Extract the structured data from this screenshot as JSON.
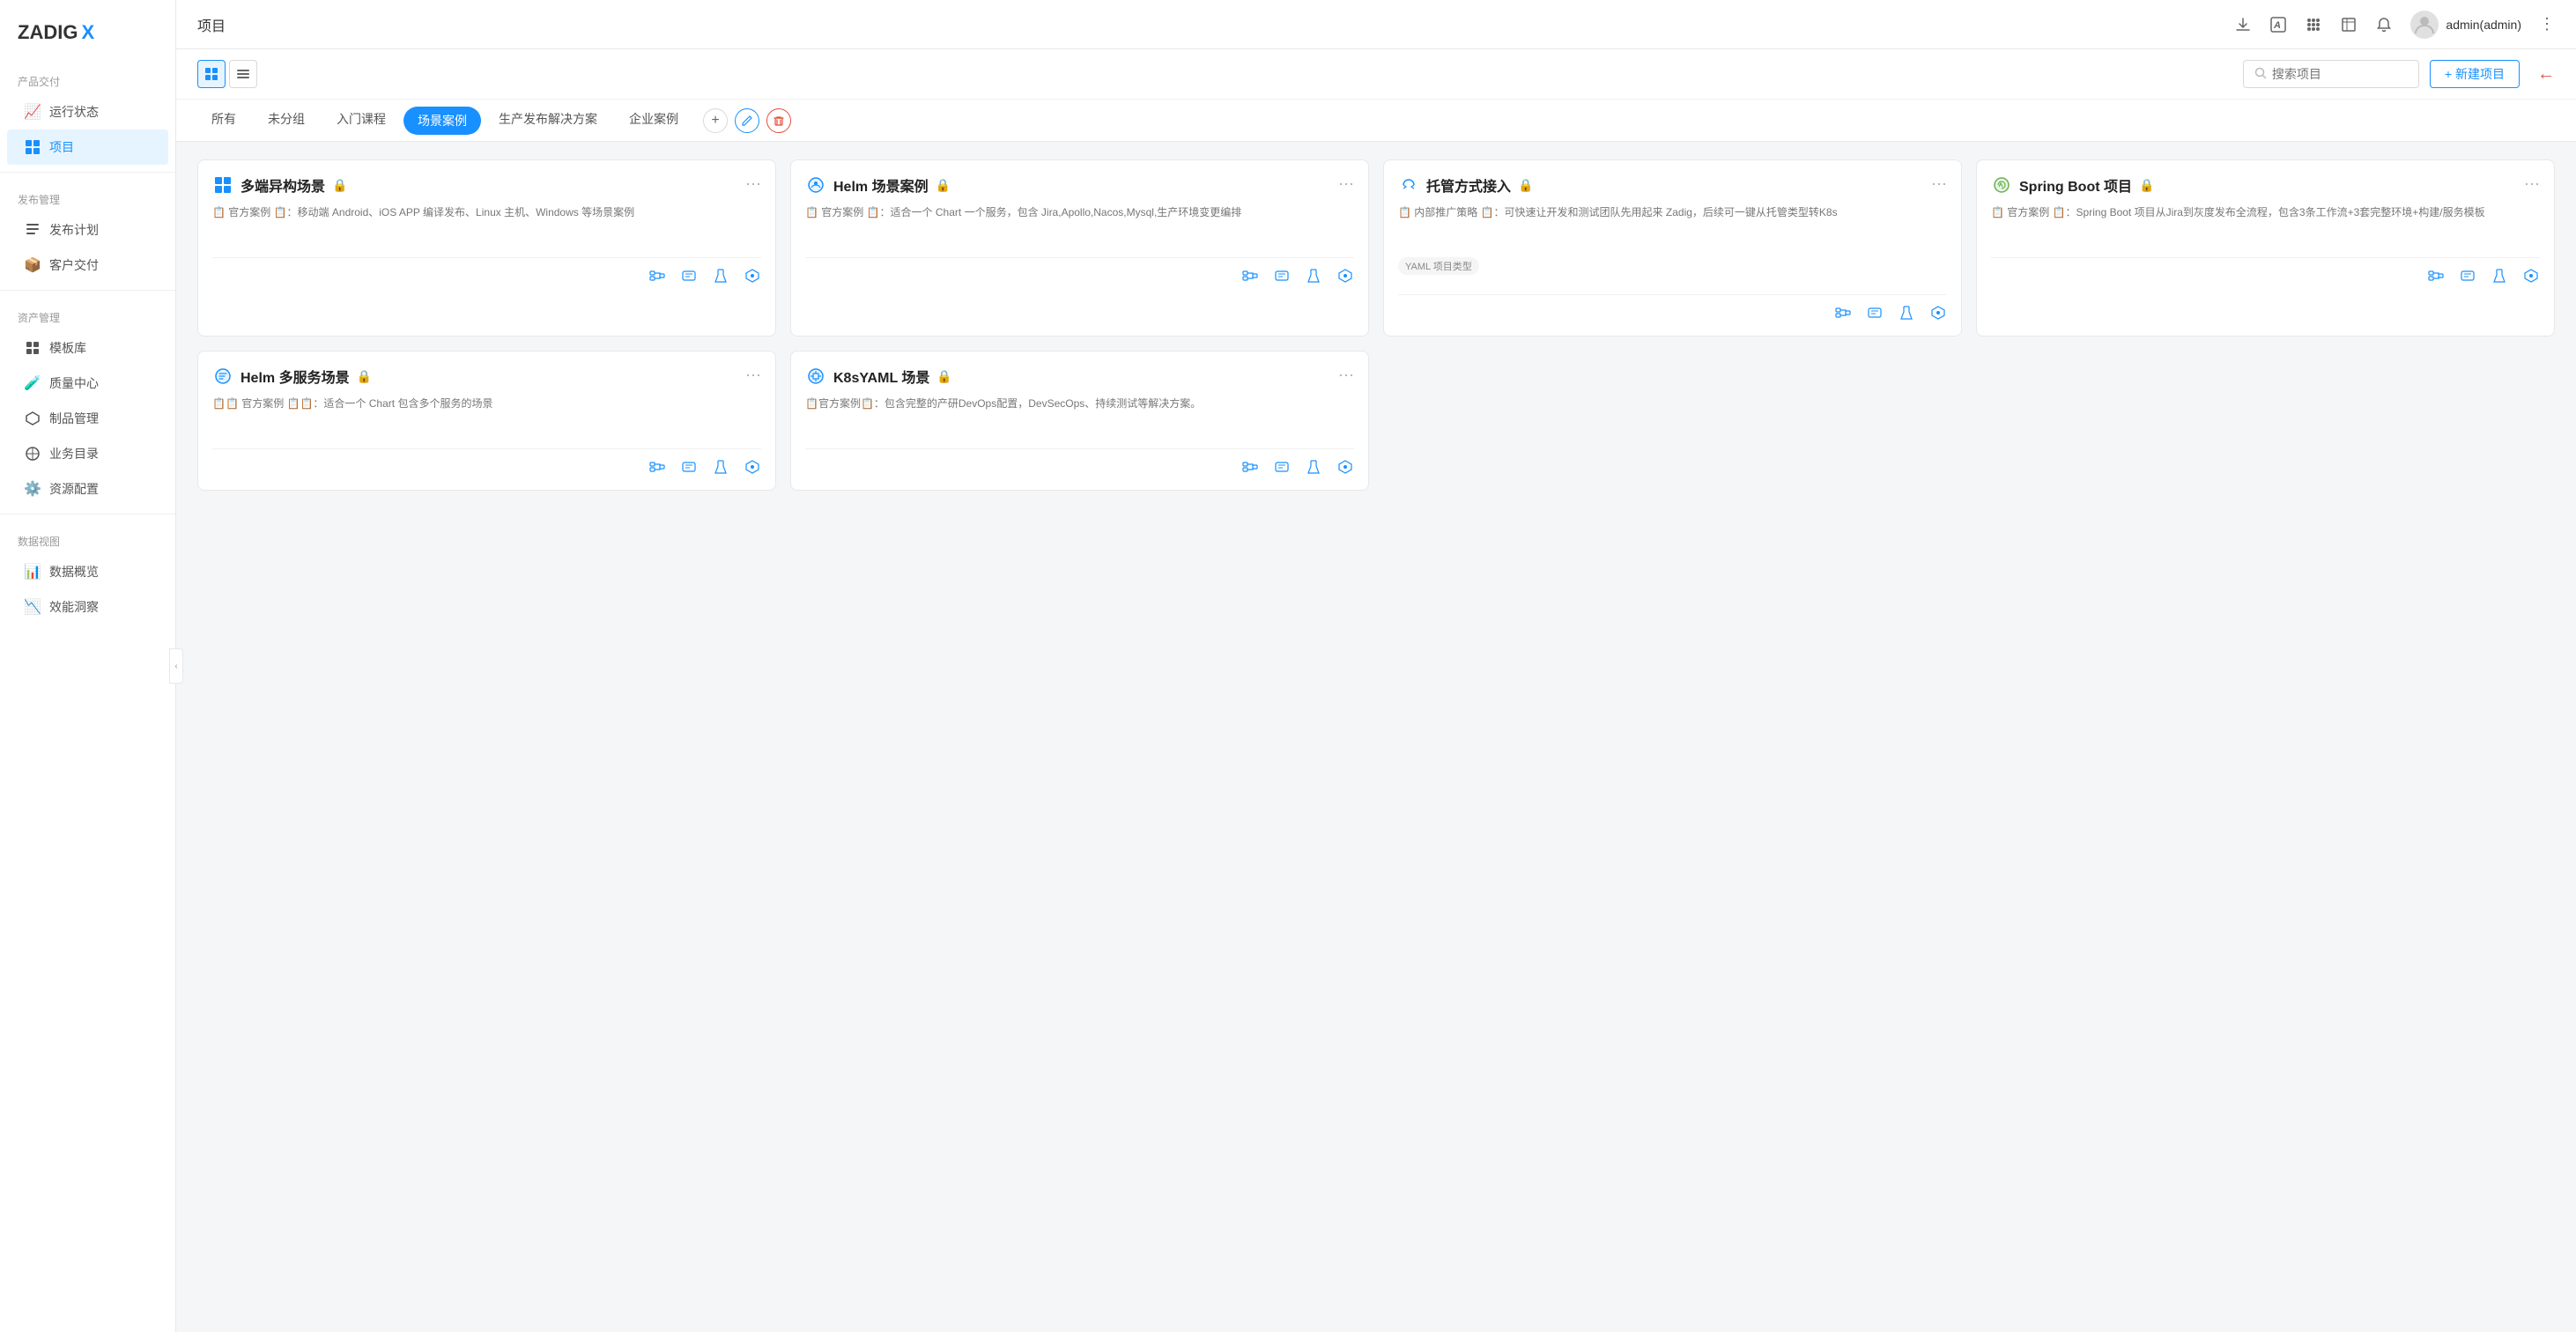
{
  "app": {
    "logo": "ZADIG",
    "logo_highlight": "X"
  },
  "sidebar": {
    "sections": [
      {
        "title": "产品交付",
        "items": [
          {
            "id": "run-status",
            "label": "运行状态",
            "icon": "📈",
            "active": false
          },
          {
            "id": "project",
            "label": "项目",
            "icon": "📋",
            "active": true
          }
        ]
      },
      {
        "title": "发布管理",
        "items": [
          {
            "id": "release-plan",
            "label": "发布计划",
            "icon": "✏️",
            "active": false
          },
          {
            "id": "client-delivery",
            "label": "客户交付",
            "icon": "📦",
            "active": false
          }
        ]
      },
      {
        "title": "资产管理",
        "items": [
          {
            "id": "template-lib",
            "label": "模板库",
            "icon": "🗂️",
            "active": false
          },
          {
            "id": "quality-center",
            "label": "质量中心",
            "icon": "🧪",
            "active": false
          },
          {
            "id": "product-mgmt",
            "label": "制品管理",
            "icon": "📦",
            "active": false
          },
          {
            "id": "biz-catalog",
            "label": "业务目录",
            "icon": "🗂️",
            "active": false
          },
          {
            "id": "resource-config",
            "label": "资源配置",
            "icon": "⚙️",
            "active": false
          }
        ]
      },
      {
        "title": "数据视图",
        "items": [
          {
            "id": "data-overview",
            "label": "数据概览",
            "icon": "📊",
            "active": false
          },
          {
            "id": "effect-insight",
            "label": "效能洞察",
            "icon": "📉",
            "active": false
          }
        ]
      }
    ]
  },
  "header": {
    "title": "项目",
    "icons": [
      "download",
      "font",
      "apps",
      "book",
      "bell"
    ],
    "user": {
      "name": "admin(admin)"
    },
    "more": "⋮"
  },
  "toolbar": {
    "view_grid_label": "⊞",
    "view_list_label": "☰",
    "search_placeholder": "搜索项目",
    "new_project_label": "+ 新建项目"
  },
  "tabs": [
    {
      "id": "all",
      "label": "所有",
      "active": false
    },
    {
      "id": "ungroup",
      "label": "未分组",
      "active": false
    },
    {
      "id": "intro",
      "label": "入门课程",
      "active": false
    },
    {
      "id": "scenario",
      "label": "场景案例",
      "active": true
    },
    {
      "id": "production",
      "label": "生产发布解决方案",
      "active": false
    },
    {
      "id": "enterprise",
      "label": "企业案例",
      "active": false
    }
  ],
  "tab_actions": {
    "add": "+",
    "edit": "✎",
    "delete": "🗑"
  },
  "cards": [
    {
      "id": "card-1",
      "icon": "📄",
      "icon_color": "#1890ff",
      "title": "多端异构场景",
      "locked": true,
      "description": "📋 官方案例 📋：移动端 Android、iOS APP 编译发布、Linux 主机、Windows 等场景案例",
      "badge": null,
      "actions": [
        "workflow",
        "env",
        "test",
        "service"
      ]
    },
    {
      "id": "card-2",
      "icon": "⛵",
      "icon_color": "#1890ff",
      "title": "Helm 场景案例",
      "locked": true,
      "description": "📋 官方案例 📋：适合一个 Chart 一个服务，包含 Jira,Apollo,Nacos,Mysql,生产环境变更编排",
      "badge": null,
      "actions": [
        "workflow",
        "env",
        "test",
        "service"
      ]
    },
    {
      "id": "card-3",
      "icon": "🐦",
      "icon_color": "#1890ff",
      "title": "托管方式接入",
      "locked": true,
      "description": "📋 内部推广策略 📋：可快速让开发和测试团队先用起来 Zadig，后续可一键从托管类型转K8s",
      "badge": "YAML 项目类型",
      "actions": [
        "workflow",
        "env",
        "test",
        "service"
      ]
    },
    {
      "id": "card-4",
      "icon": "🍃",
      "icon_color": "#6ab04c",
      "title": "Spring Boot 项目",
      "locked": true,
      "description": "📋 官方案例 📋：Spring Boot 项目从Jira到灰度发布全流程，包含3条工作流+3套完整环境+构建/服务模板",
      "badge": null,
      "actions": [
        "workflow",
        "env",
        "test",
        "service"
      ]
    },
    {
      "id": "card-5",
      "icon": "⚙️",
      "icon_color": "#1890ff",
      "title": "Helm 多服务场景",
      "locked": true,
      "description": "📋📋 官方案例 📋📋：适合一个 Chart 包含多个服务的场景",
      "badge": null,
      "actions": [
        "workflow",
        "env",
        "test",
        "service"
      ]
    },
    {
      "id": "card-6",
      "icon": "⚙️",
      "icon_color": "#1890ff",
      "title": "K8sYAML 场景",
      "locked": true,
      "description": "📋官方案例📋：包含完整的产研DevOps配置，DevSecOps、持续测试等解决方案。",
      "badge": null,
      "actions": [
        "workflow",
        "env",
        "test",
        "service"
      ]
    }
  ]
}
